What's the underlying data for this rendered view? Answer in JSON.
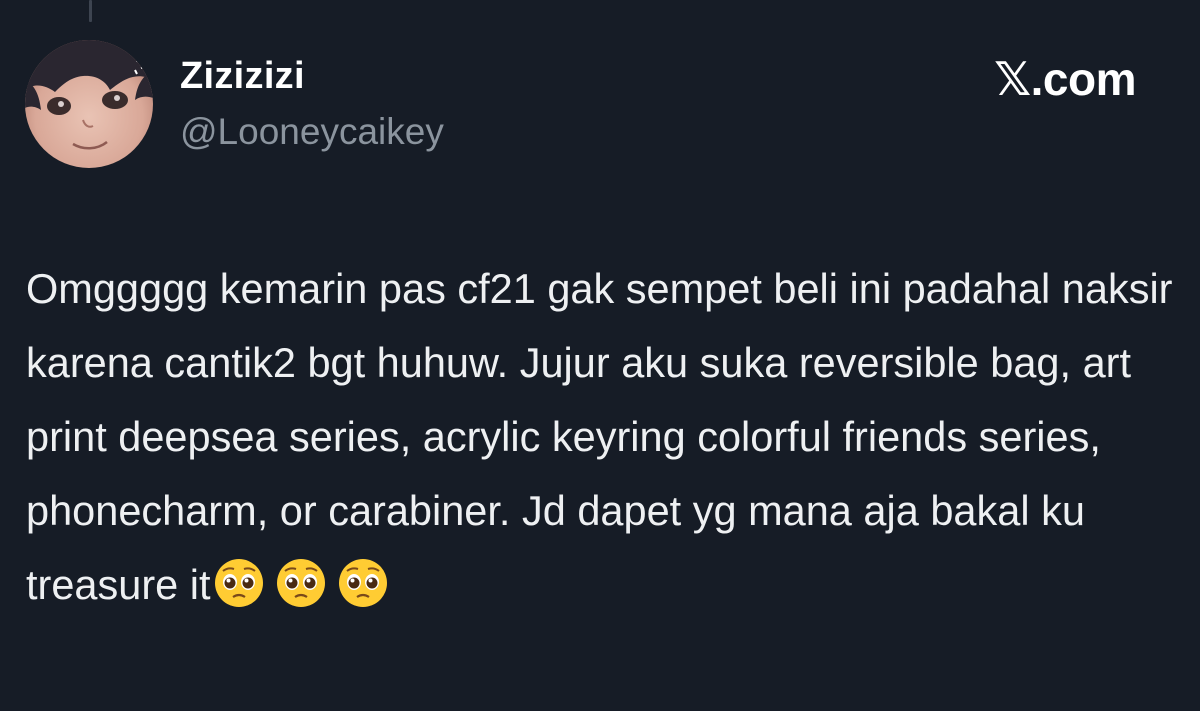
{
  "tweet": {
    "author": {
      "display_name": "Zizizizi",
      "handle": "@Looneycaikey",
      "avatar_icon": "avatar-portrait"
    },
    "brand": "𝕏.com",
    "text": "Omggggg kemarin pas cf21 gak sempet beli ini padahal naksir karena cantik2 bgt huhuw. Jujur aku suka reversible bag, art print deepsea series, acrylic keyring colorful friends series, phonecharm, or carabiner. Jd dapet yg mana aja bakal ku treasure it",
    "emojis": [
      "pleading-face-icon",
      "pleading-face-icon",
      "pleading-face-icon"
    ]
  },
  "colors": {
    "background": "#161c26",
    "text_primary": "#ffffff",
    "text_secondary": "#8b949e",
    "emoji_yellow": "#ffcc33"
  }
}
